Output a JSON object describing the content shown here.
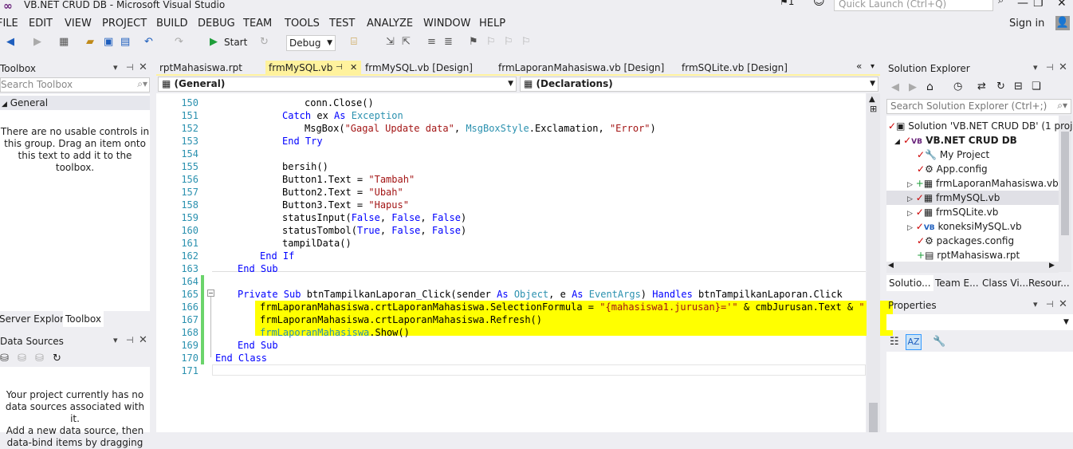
{
  "window": {
    "title": "VB.NET CRUD DB - Microsoft Visual Studio",
    "quick_launch": "Quick Launch (Ctrl+Q)",
    "notif": "1",
    "sign_in": "Sign in"
  },
  "menu": [
    "FILE",
    "EDIT",
    "VIEW",
    "PROJECT",
    "BUILD",
    "DEBUG",
    "TEAM",
    "TOOLS",
    "TEST",
    "ANALYZE",
    "WINDOW",
    "HELP"
  ],
  "toolbar": {
    "start": "Start",
    "config": "Debug"
  },
  "toolbox": {
    "title": "Toolbox",
    "search": "Search Toolbox",
    "group": "General",
    "empty": [
      "There are no usable controls in",
      "this group. Drag an item onto",
      "this text to add it to the toolbox."
    ],
    "tabs": [
      "Server Explorer",
      "Toolbox"
    ]
  },
  "datasources": {
    "title": "Data Sources",
    "msg": [
      "Your project currently has no",
      "data sources associated with it.",
      "Add a new data source, then",
      "data-bind items by dragging"
    ]
  },
  "tabs": [
    "rptMahasiswa.rpt",
    "frmMySQL.vb",
    "frmMySQL.vb [Design]",
    "frmLaporanMahasiswa.vb [Design]",
    "frmSQLite.vb [Design]"
  ],
  "nav": {
    "left": "(General)",
    "right": "(Declarations)"
  },
  "code": {
    "lines": [
      "150",
      "151",
      "152",
      "153",
      "154",
      "155",
      "156",
      "157",
      "158",
      "159",
      "160",
      "161",
      "162",
      "163",
      "164",
      "165",
      "166",
      "167",
      "168",
      "169",
      "170",
      "171"
    ],
    "l150": "conn.Close()",
    "l151a": "Catch",
    " l151b": "ex",
    "l151c": "As",
    "l151d": "Exception",
    "l152a": "MsgBox(",
    "l152b": "\"Gagal Update data\"",
    "l152c": ", ",
    "l152d": "MsgBoxStyle",
    ".l152e": ".Exclamation, ",
    "l152f": "\"Error\"",
    "l152g": ")",
    "l153": "End Try",
    "l155": "bersih()",
    "l156a": "Button1.Text = ",
    "l156b": "\"Tambah\"",
    "l157a": "Button2.Text = ",
    "l157b": "\"Ubah\"",
    "l158a": "Button3.Text = ",
    "l158b": "\"Hapus\"",
    "l159a": "statusInput(",
    "l159b": "False",
    "l160a": "statusTombol(",
    "l160b": "True",
    "l160c": "False",
    "l161": "tampilData()",
    "l162": "End If",
    "l163": "End Sub",
    "l165a": "Private Sub",
    "l165b": " btnTampilkanLaporan_Click(sender ",
    "l165c": "As",
    "l165d": "Object",
    "l165e": ", e ",
    "l165f": "EventArgs",
    "l165g": "Handles",
    "l165h": " btnTampilkanLaporan.Click",
    "l166a": "frmLaporanMahasiswa.crtLaporanMahasiswa.SelectionFormula = ",
    "l166b": "\"{mahasiswa1.jurusan}='\"",
    "l166c": " & cmbJurusan.Text & ",
    "l166d": "\"'\"",
    "l167": "frmLaporanMahasiswa.crtLaporanMahasiswa.Refresh()",
    "l168a": "frmLaporanMahasiswa",
    "l168b": ".Show()",
    "l169": "End Sub",
    "l170a": "End Class"
  },
  "solution": {
    "title": "Solution Explorer",
    "search": "Search Solution Explorer (Ctrl+;)",
    "items": [
      "Solution 'VB.NET CRUD DB' (1 proj",
      "VB.NET CRUD DB",
      "My Project",
      "App.config",
      "frmLaporanMahasiswa.vb",
      "frmMySQL.vb",
      "frmSQLite.vb",
      "koneksiMySQL.vb",
      "packages.config",
      "rptMahasiswa.rpt"
    ],
    "tabs": [
      "Solutio...",
      "Team E...",
      "Class Vi...",
      "Resour..."
    ]
  },
  "properties": {
    "title": "Properties"
  },
  "colors": {
    "highlight": "#ffff00",
    "active_tab": "#fff29d",
    "keyword": "#0000ff",
    "type": "#2b91af",
    "string": "#a31515"
  }
}
